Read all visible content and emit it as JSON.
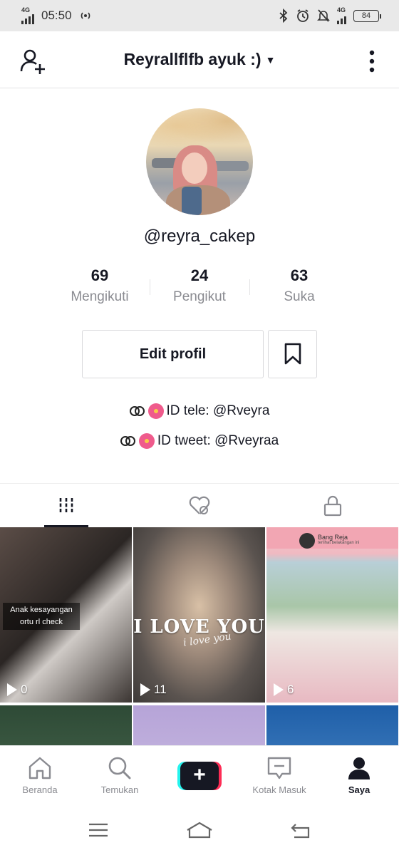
{
  "status_bar": {
    "network_1": "4G",
    "time": "05:50",
    "network_2": "4G",
    "battery": "84"
  },
  "header": {
    "title": "Reyrallflfb ayuk :)",
    "add_user_icon": "person-add-icon",
    "more_icon": "more-vertical-icon"
  },
  "profile": {
    "username": "@reyra_cakep",
    "stats": [
      {
        "value": "69",
        "label": "Mengikuti"
      },
      {
        "value": "24",
        "label": "Pengikut"
      },
      {
        "value": "63",
        "label": "Suka"
      }
    ],
    "edit_button": "Edit profil",
    "bio_lines": [
      "ID tele: @Rveyra",
      "ID tweet: @Rveyraa"
    ]
  },
  "tabs": [
    {
      "icon": "grid-icon",
      "active": true
    },
    {
      "icon": "liked-hidden-icon",
      "active": false
    },
    {
      "icon": "lock-icon",
      "active": false
    }
  ],
  "videos": [
    {
      "caption": "Anak kesayangan ortu rl check",
      "views": "0"
    },
    {
      "overlay_title": "I LOVE YOU",
      "overlay_sub": "i love you",
      "views": "11"
    },
    {
      "chat_name": "Bang Reja",
      "chat_sub": "terlihat belakangan ini",
      "views": "6"
    },
    {
      "views": ""
    },
    {
      "views": ""
    },
    {
      "views": ""
    }
  ],
  "bottom_nav": [
    {
      "label": "Beranda",
      "icon": "home-icon"
    },
    {
      "label": "Temukan",
      "icon": "search-icon"
    },
    {
      "label": "+",
      "icon": "create-icon"
    },
    {
      "label": "Kotak Masuk",
      "icon": "inbox-icon"
    },
    {
      "label": "Saya",
      "icon": "profile-icon"
    }
  ],
  "colors": {
    "text_primary": "#161823",
    "text_secondary": "#8a8b91",
    "create_cyan": "#25f4ee",
    "create_pink": "#fe2c55"
  }
}
